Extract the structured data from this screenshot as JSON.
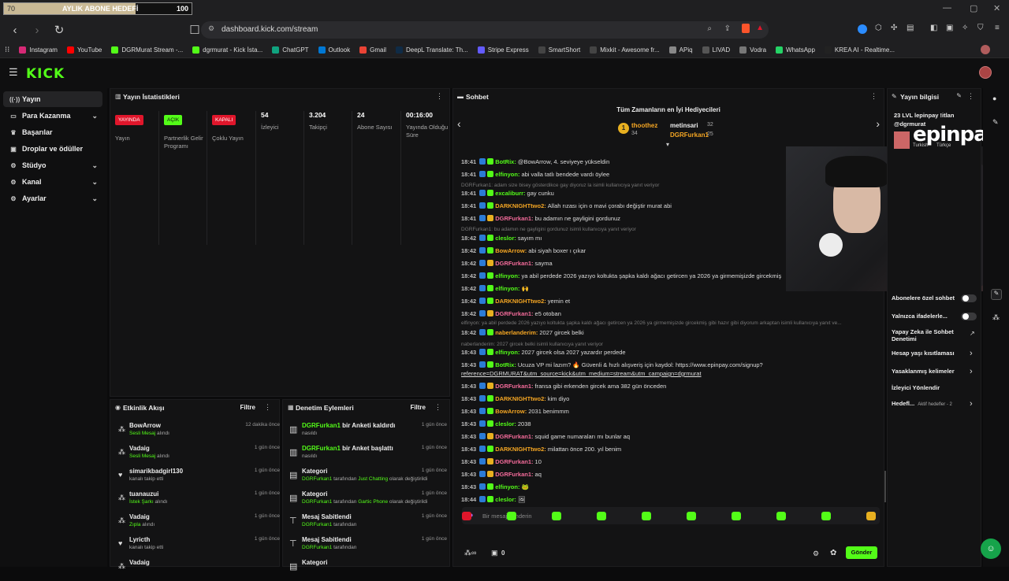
{
  "subgoal": {
    "current": "70",
    "label": "AYLIK ABONE HEDEFİ",
    "target": "100",
    "progress": 0.7
  },
  "browser": {
    "url": "dashboard.kick.com/stream"
  },
  "bookmarks": [
    "Instagram",
    "YouTube",
    "DGRMurat Stream -...",
    "dgrmurat - Kick İsta...",
    "ChatGPT",
    "Outlook",
    "Gmail",
    "DeepL Translate: Th...",
    "Stripe Express",
    "SmartShort",
    "Mixkit - Awesome fr...",
    "APiq",
    "LIVAD",
    "Vodra",
    "WhatsApp",
    "KREA AI - Realtime..."
  ],
  "sidebar": {
    "items": [
      {
        "label": "Yayın",
        "icon": "broadcast-icon"
      },
      {
        "label": "Para Kazanma",
        "icon": "money-icon"
      },
      {
        "label": "Başarılar",
        "icon": "trophy-icon"
      },
      {
        "label": "Droplar ve ödüller",
        "icon": "gift-icon"
      },
      {
        "label": "Stüdyo",
        "icon": "studio-icon"
      },
      {
        "label": "Kanal",
        "icon": "channel-icon"
      },
      {
        "label": "Ayarlar",
        "icon": "gear-icon"
      }
    ]
  },
  "stats": {
    "title": "Yayın İstatistikleri",
    "items": [
      {
        "badge": "YAYINDA",
        "label": "Yayın",
        "color": "#e0162b"
      },
      {
        "badge": "AÇIK",
        "label": "Partnerlik Gelir Programı",
        "color": "#53fc18"
      },
      {
        "badge": "KAPALI",
        "label": "Çoklu Yayın",
        "color": "#e0162b"
      },
      {
        "value": "54",
        "label": "İzleyici"
      },
      {
        "value": "3.204",
        "label": "Takipçi"
      },
      {
        "value": "24",
        "label": "Abone Sayısı"
      },
      {
        "value": "00:16:00",
        "label": "Yayında Olduğu Süre"
      }
    ]
  },
  "activity": {
    "title": "Etkinlik Akışı",
    "filter": "Filtre",
    "rows": [
      {
        "name": "BowArrow",
        "hl": "Sesli Mesaj",
        "rest": "alındı",
        "time": "12 dakika önce"
      },
      {
        "name": "Vadaig",
        "hl": "Sesli Mesaj",
        "rest": "alındı",
        "time": "1 gün önce"
      },
      {
        "name": "simarikbadgirl130",
        "hl": "",
        "rest": "kanalı takip etti",
        "time": "1 gün önce"
      },
      {
        "name": "tuanauzui",
        "hl": "İstek Şarkı",
        "rest": "alındı",
        "time": "1 gün önce"
      },
      {
        "name": "Vadaig",
        "hl": "Zıpla",
        "rest": "alındı",
        "time": "1 gün önce"
      },
      {
        "name": "Lyricth",
        "hl": "",
        "rest": "kanalı takip etti",
        "time": "1 gün önce"
      },
      {
        "name": "Vadaig",
        "hl": "",
        "rest": "",
        "time": ""
      }
    ]
  },
  "moderation": {
    "title": "Denetim Eylemleri",
    "filter": "Filtre",
    "rows": [
      {
        "actor": "DGRFurkan1",
        "title": " bir Anketi kaldırdı",
        "sub": "nasıldı",
        "time": "1 gün önce"
      },
      {
        "actor": "DGRFurkan1",
        "title": " bir Anket başlattı",
        "sub": "nasıldı",
        "time": "1 gün önce"
      },
      {
        "actor": "",
        "title": "Kategori",
        "sub_actor": "DGRFurkan1",
        "sub": " tarafından ",
        "sub_hl": "Just Chatting",
        "sub_end": " olarak değiştirildi",
        "time": "1 gün önce"
      },
      {
        "actor": "",
        "title": "Kategori",
        "sub_actor": "DGRFurkan1",
        "sub": " tarafından ",
        "sub_hl": "Gartic Phone",
        "sub_end": " olarak değiştirildi",
        "time": "1 gün önce"
      },
      {
        "actor": "",
        "title": "Mesaj Sabitlendi",
        "sub_actor": "DGRFurkan1",
        "sub": " tarafından",
        "time": "1 gün önce"
      },
      {
        "actor": "",
        "title": "Mesaj Sabitlendi",
        "sub_actor": "DGRFurkan1",
        "sub": " tarafından",
        "time": "1 gün önce"
      },
      {
        "actor": "",
        "title": "Kategori",
        "sub": "",
        "time": ""
      }
    ]
  },
  "chat": {
    "title": "Sohbet",
    "top_gifters_title": "Tüm Zamanların en İyi Hediyecileri",
    "gifters": [
      {
        "name": "thoothez",
        "count": "34"
      },
      {
        "name": "metinsari",
        "count": "32"
      },
      {
        "name": "DGRFurkan1",
        "count": "25"
      }
    ],
    "messages": [
      {
        "time": "18:41",
        "user": "BotRix:",
        "color": "#53fc18",
        "text": "@BowArrow, 4. seviyeye yükseldin"
      },
      {
        "time": "18:41",
        "user": "elfinyon:",
        "color": "#53fc18",
        "text": "abi valla tatlı bendede vardı öylee"
      },
      {
        "reply": "DGRFurkan1: adam size bisey gösterdikce gay diyoruz la isimli kullanıcıya yanıt veriyor"
      },
      {
        "time": "18:41",
        "user": "excaliburr:",
        "color": "#53fc18",
        "text": "gay cunku"
      },
      {
        "time": "18:41",
        "user": "DARKNIGHTtwo2:",
        "color": "#f5a623",
        "text": "Allah rızası için o mavi çorabı değiştir murat abi"
      },
      {
        "time": "18:41",
        "user": "DGRFurkan1:",
        "color": "#f46b9a",
        "text": "bu adamın ne gayligini gordunuz"
      },
      {
        "reply": "DGRFurkan1: bu adamın ne gayligini gordunuz isimli kullanıcıya yanıt veriyor"
      },
      {
        "time": "18:42",
        "user": "cleslor:",
        "color": "#53fc18",
        "text": "sayım mı"
      },
      {
        "time": "18:42",
        "user": "BowArrow:",
        "color": "#f5a623",
        "text": "abi siyah boxer ı çıkar"
      },
      {
        "time": "18:42",
        "user": "DGRFurkan1:",
        "color": "#f46b9a",
        "text": "sayma"
      },
      {
        "time": "18:42",
        "user": "elfinyon:",
        "color": "#53fc18",
        "text": "ya abil perdede 2026 yazıyo koltukta şapka kaldı ağacı getircen ya 2026 ya girmemişizde gircekmiş"
      },
      {
        "time": "18:42",
        "user": "elfinyon:",
        "color": "#53fc18",
        "text": "🙌"
      },
      {
        "time": "18:42",
        "user": "DARKNIGHTtwo2:",
        "color": "#f5a623",
        "text": "yemin et"
      },
      {
        "time": "18:42",
        "user": "DGRFurkan1:",
        "color": "#f46b9a",
        "text": "e5 otoban"
      },
      {
        "reply": "elfinyon: ya abil perdede 2026 yazıyo koltukta şapka kaldı ağacı getircen ya 2026 ya girmemişizde gircekmiş gibi hazır gibi diyorum arkaptan isimli kullanıcıya yanıt ve..."
      },
      {
        "time": "18:42",
        "user": "naberlanderim:",
        "color": "#f5a623",
        "text": "2027 gircek belki"
      },
      {
        "reply": "naberlanderim: 2027 gircek belki isimli kullanıcıya yanıt veriyor"
      },
      {
        "time": "18:43",
        "user": "elfinyon:",
        "color": "#53fc18",
        "text": "2027 gircek olsa 2027 yazardır perdede"
      },
      {
        "time": "18:43",
        "user": "BotRix:",
        "color": "#53fc18",
        "text": "Ucuza VP mi lazım? 🔥 Güvenli & hızlı alışveriş için kaydol: https://www.epinpay.com/signup?"
      },
      {
        "cont": "reference=DGRMURAT&utm_source=kick&utm_medium=stream&utm_campaign=dgrmurat"
      },
      {
        "time": "18:43",
        "user": "DGRFurkan1:",
        "color": "#f46b9a",
        "text": "fransa gibi erkenden gircek ama 382 gün önceden"
      },
      {
        "time": "18:43",
        "user": "DARKNIGHTtwo2:",
        "color": "#f5a623",
        "text": "kim diyo"
      },
      {
        "time": "18:43",
        "user": "BowArrow:",
        "color": "#f5a623",
        "text": "2031 benimmm"
      },
      {
        "time": "18:43",
        "user": "cleslor:",
        "color": "#53fc18",
        "text": "2038"
      },
      {
        "time": "18:43",
        "user": "DGRFurkan1:",
        "color": "#f46b9a",
        "text": "squid game numaraları mı bunlar aq"
      },
      {
        "time": "18:43",
        "user": "DARKNIGHTtwo2:",
        "color": "#f5a623",
        "text": "milattan önce 200. yıl benim"
      },
      {
        "time": "18:43",
        "user": "DGRFurkan1:",
        "color": "#f46b9a",
        "text": "10"
      },
      {
        "time": "18:43",
        "user": "DGRFurkan1:",
        "color": "#f46b9a",
        "text": "aq"
      },
      {
        "time": "18:43",
        "user": "elfinyon:",
        "color": "#53fc18",
        "text": "🐸"
      },
      {
        "time": "18:44",
        "user": "cleslor:",
        "color": "#53fc18",
        "text": "🖼"
      }
    ],
    "input_placeholder": "Bir mesaj gönderin",
    "send": "Gönder",
    "points": "0"
  },
  "stream_info": {
    "title": "Yayın bilgisi",
    "desc_line1": "23 LVL lepinpay !itlan",
    "desc_line2": "@dgrmurat",
    "overlay_brand": "epinpay",
    "cat1": "Turkish",
    "cat2": "Türkçe"
  },
  "settings": [
    {
      "label": "Abonelere özel sohbet",
      "type": "toggle"
    },
    {
      "label": "Yalnızca ifadelerle...",
      "type": "toggle"
    },
    {
      "label": "Yapay Zeka ile Sohbet Denetimi",
      "type": "ext"
    },
    {
      "label": "Hesap yaşı kısıtlaması",
      "type": "chev"
    },
    {
      "label": "Yasaklanmış kelimeler",
      "type": "chev"
    },
    {
      "label": "İzleyici Yönlendir",
      "type": "none"
    },
    {
      "label": "Hedefl...",
      "sub": "Aktif hedefler - 2",
      "type": "chev"
    }
  ]
}
